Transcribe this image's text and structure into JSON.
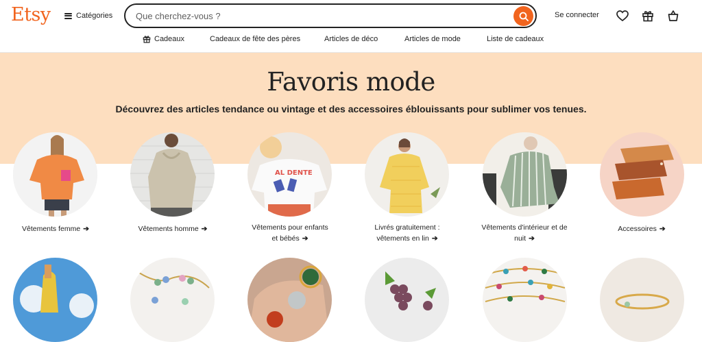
{
  "header": {
    "logo": "Etsy",
    "categories_label": "Catégories",
    "search_placeholder": "Que cherchez-vous ?",
    "signin_label": "Se connecter",
    "accent": "#f1641e"
  },
  "nav": {
    "items": [
      {
        "label": "Cadeaux",
        "icon": "gift-icon"
      },
      {
        "label": "Cadeaux de fête des pères"
      },
      {
        "label": "Articles de déco"
      },
      {
        "label": "Articles de mode"
      },
      {
        "label": "Liste de cadeaux"
      }
    ]
  },
  "hero": {
    "title": "Favoris mode",
    "subtitle": "Découvrez des articles tendance ou vintage et des accessoires éblouissants pour sublimer vos tenues.",
    "background": "#fddebf"
  },
  "categories": [
    {
      "line1": "Vêtements femme",
      "line2": ""
    },
    {
      "line1": "Vêtements homme",
      "line2": ""
    },
    {
      "line1": "Vêtements pour enfants",
      "line2": "et bébés"
    },
    {
      "line1": "Livrés gratuitement :",
      "line2": "vêtements en lin"
    },
    {
      "line1": "Vêtements d'intérieur et de",
      "line2": "nuit"
    },
    {
      "line1": "Accessoires",
      "line2": ""
    }
  ],
  "arrow": "➔",
  "second_row_count": 6
}
